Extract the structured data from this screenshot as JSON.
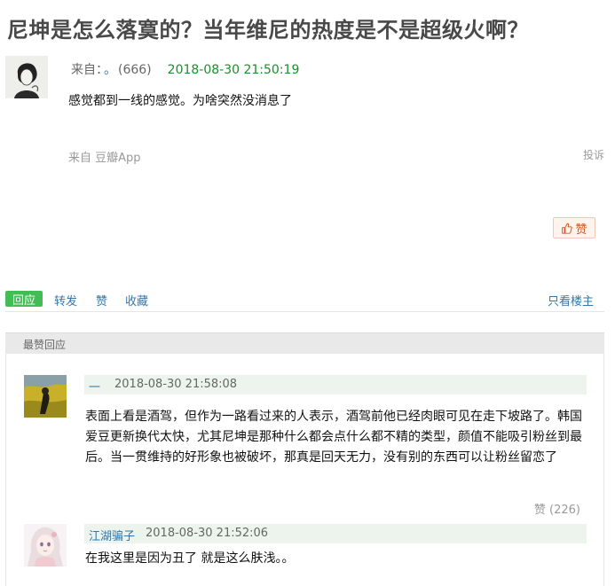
{
  "post": {
    "title": "尼坤是怎么落寞的？当年维尼的热度是不是超级火啊？",
    "author_prefix": "来自：",
    "author": "。",
    "author_count": "(666)",
    "time": "2018-08-30 21:50:19",
    "body": "感觉都到一线的感觉。为啥突然没消息了",
    "source": "来自 豆瓣App",
    "report": "投诉",
    "like_label": "赞"
  },
  "actions": {
    "reply": "回应",
    "repost": "转发",
    "like": "赞",
    "collect": "收藏",
    "owner_only": "只看楼主"
  },
  "best": {
    "header": "最赞回应",
    "replies": [
      {
        "author": "一",
        "time": "2018-08-30 21:58:08",
        "body": "表面上看是酒驾，但作为一路看过来的人表示，酒驾前他已经肉眼可见在走下坡路了。韩国爱豆更新换代太快，尤其尼坤是那种什么都会点什么都不精的类型，颜值不能吸引粉丝到最后。当一贯维持的好形象也被破坏，那真是回天无力，没有别的东西可以让粉丝留恋了",
        "likes": "赞 (226)"
      },
      {
        "author": "江湖骗子",
        "time": "2018-08-30 21:52:06",
        "body": "在我这里是因为丑了 就是这么肤浅。。"
      }
    ]
  },
  "colors": {
    "accent_green": "#42bd56",
    "link_blue": "#3377aa",
    "time_green": "#1a8f2a"
  }
}
